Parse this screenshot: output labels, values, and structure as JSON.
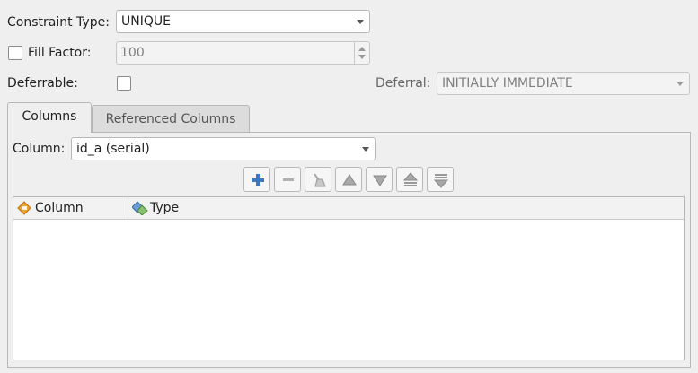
{
  "constraint_type": {
    "label": "Constraint Type:",
    "value": "UNIQUE"
  },
  "fill_factor": {
    "label": "Fill Factor:",
    "value": "100",
    "checked": false
  },
  "deferrable": {
    "label": "Deferrable:",
    "checked": false
  },
  "deferral": {
    "label": "Deferral:",
    "value": "INITIALLY IMMEDIATE"
  },
  "tabs": [
    {
      "label": "Columns",
      "active": true
    },
    {
      "label": "Referenced Columns",
      "active": false
    }
  ],
  "column_selector": {
    "label": "Column:",
    "value": "id_a (serial)"
  },
  "toolbar": [
    {
      "name": "add-button",
      "icon": "plus-icon",
      "enabled": true
    },
    {
      "name": "remove-button",
      "icon": "minus-icon",
      "enabled": false
    },
    {
      "name": "clear-button",
      "icon": "broom-icon",
      "enabled": false
    },
    {
      "name": "move-up-button",
      "icon": "arrow-up-icon",
      "enabled": false
    },
    {
      "name": "move-down-button",
      "icon": "arrow-down-icon",
      "enabled": false
    },
    {
      "name": "move-top-button",
      "icon": "double-arrow-up-icon",
      "enabled": false
    },
    {
      "name": "move-bottom-button",
      "icon": "double-arrow-down-icon",
      "enabled": false
    }
  ],
  "table": {
    "columns": [
      {
        "label": "Column",
        "icon": "column-icon"
      },
      {
        "label": "Type",
        "icon": "type-icon"
      }
    ],
    "rows": []
  },
  "colors": {
    "accent": "#3b78c2",
    "window_bg": "#efefef"
  }
}
